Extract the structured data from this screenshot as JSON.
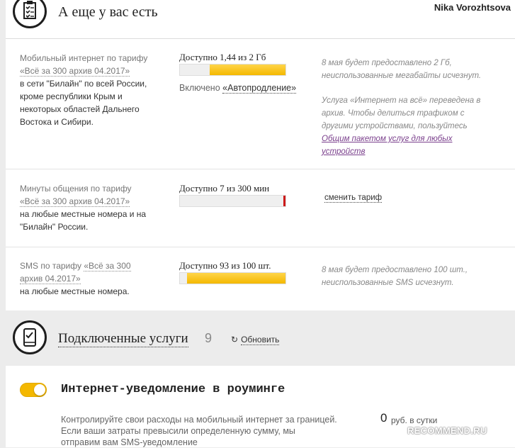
{
  "header": {
    "title": "А еще у вас есть",
    "user_name": "Nika Vorozhtsova"
  },
  "internet": {
    "line1": "Мобильный интернет по тарифу",
    "tariff_link": "«Всё за 300 архив 04.2017»",
    "line2": "в сети \"Билайн\" по всей России,",
    "line3": "кроме республики Крым и",
    "line4": "некоторых областей Дальнего",
    "line5": "Востока и Сибири.",
    "available": "Доступно 1,44 из 2 Гб",
    "remaining_fraction": 0.72,
    "included_label": "Включено",
    "included_link": "«Автопродление»",
    "note1_l1": "8 мая будет предоставлено 2 Гб,",
    "note1_l2": "неиспользованные мегабайты исчезнут.",
    "note2_l1": "Услуга «Интернет на всё» переведена в",
    "note2_l2": "архив. Чтобы делиться трафиком с",
    "note2_l3": "другими устройствами, пользуйтесь",
    "note2_link_l1": "Общим пакетом услуг для любых",
    "note2_link_l2": "устройств"
  },
  "minutes": {
    "line1": "Минуты общения по тарифу",
    "tariff_link": "«Всё за 300 архив 04.2017»",
    "line2": "на любые местные номера и на",
    "line3": "\"Билайн\" России.",
    "available": "Доступно 7 из 300 мин",
    "remaining_fraction": 0.023,
    "change_link": "сменить тариф"
  },
  "sms": {
    "line1_prefix": "SMS по тарифу",
    "tariff_link_l1": "«Всё за 300",
    "tariff_link_l2": "архив 04.2017»",
    "line2": "на любые местные номера.",
    "available": "Доступно 93 из 100 шт.",
    "remaining_fraction": 0.93,
    "note_l1": "8 мая будет предоставлено 100 шт.,",
    "note_l2": "неиспользованные SMS исчезнут."
  },
  "services": {
    "title": "Подключенные услуги",
    "count": "9",
    "refresh_label": "Обновить",
    "item": {
      "name": "Интернет-уведомление в роуминге",
      "desc_l1": "Контролируйте свои расходы на мобильный интернет за границей.",
      "desc_l2": "Если ваши затраты превысили определенную сумму, мы",
      "desc_l3": "отправим вам SMS-уведомление",
      "price": "0",
      "price_unit": "руб. в сутки",
      "enabled": true
    }
  },
  "watermark": "RECOMMEND.RU",
  "colors": {
    "accent_yellow": "#f4b800",
    "bar_red": "#cc1a1a",
    "link_purple": "#7a3f8c"
  }
}
